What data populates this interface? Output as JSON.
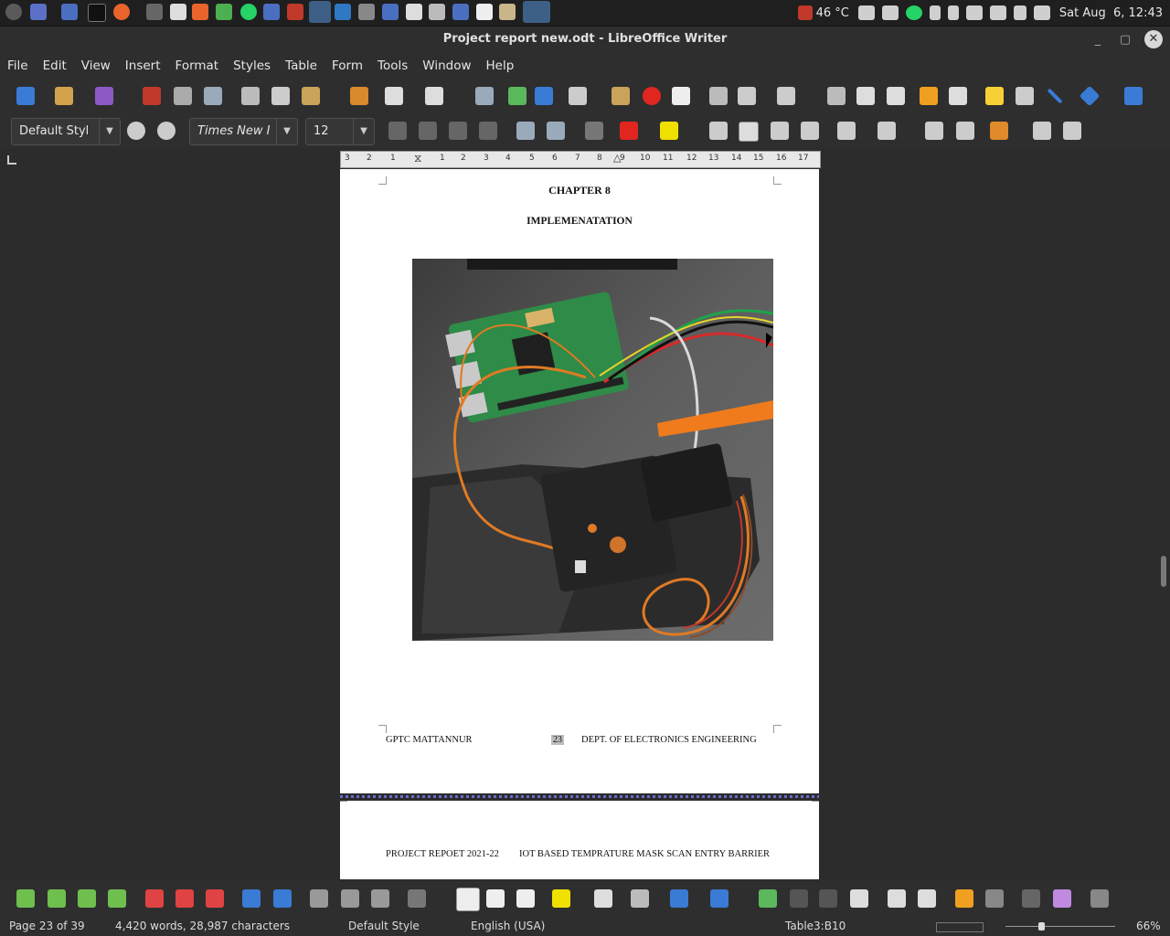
{
  "panel": {
    "temperature": "46 °C",
    "datetime": "Sat Aug  6, 12:43"
  },
  "window": {
    "title": "Project report new.odt - LibreOffice Writer"
  },
  "menu": [
    "File",
    "Edit",
    "View",
    "Insert",
    "Format",
    "Styles",
    "Table",
    "Form",
    "Tools",
    "Window",
    "Help"
  ],
  "formatting": {
    "paragraph_style": "Default Styl",
    "font_name": "Times New I",
    "font_size": "12"
  },
  "ruler": {
    "numbers": [
      "3",
      "2",
      "1",
      "1",
      "2",
      "3",
      "4",
      "5",
      "6",
      "7",
      "8",
      "9",
      "10",
      "11",
      "12",
      "13",
      "14",
      "15",
      "16",
      "17"
    ]
  },
  "document": {
    "chapter": "CHAPTER 8",
    "heading": "IMPLEMENATATION",
    "footer_left": "GPTC MATTANNUR",
    "footer_page": "23",
    "footer_right": "DEPT. OF ELECTRONICS ENGINEERING",
    "next_header_left": "PROJECT REPOET 2021-22",
    "next_header_right": "IOT BASED TEMPRATURE MASK SCAN ENTRY BARRIER"
  },
  "status": {
    "page": "Page 23 of 39",
    "words": "4,420 words, 28,987 characters",
    "page_style": "Default Style",
    "language": "English (USA)",
    "cell": "Table3:B10",
    "zoom": "66%"
  },
  "colors": {
    "accent": "#3d5f86",
    "font_color": "#e0261e",
    "highlight": "#f0e000"
  }
}
